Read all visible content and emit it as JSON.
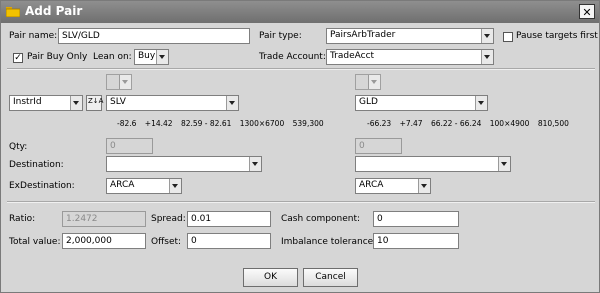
{
  "window": {
    "title": "Add Pair",
    "close_label": "✕"
  },
  "top": {
    "pair_name_label": "Pair name:",
    "pair_name_value": "SLV/GLD",
    "pair_type_label": "Pair type:",
    "pair_type_value": "PairsArbTrader",
    "pause_targets_label": "Pause targets first",
    "pause_targets_checked": false,
    "pair_buy_only_label": "Pair Buy Only",
    "pair_buy_only_checked": true,
    "lean_on_label": "Lean on:",
    "lean_on_value": "Buy",
    "trade_account_label": "Trade Account:",
    "trade_account_value": "TradeAcct"
  },
  "legs": {
    "instr_id_value": "InstrId",
    "sort_icon_text": "Z↓A",
    "left": {
      "symbol": "SLV",
      "quote": [
        "-82.6",
        "+14.42",
        "82.59 - 82.61",
        "1300×6700",
        "539,300"
      ],
      "qty": "0",
      "destination": "",
      "exdestination": "ARCA"
    },
    "right": {
      "symbol": "GLD",
      "quote": [
        "-66.23",
        "+7.47",
        "66.22 - 66.24",
        "100×4900",
        "810,500"
      ],
      "qty": "0",
      "destination": "",
      "exdestination": "ARCA"
    },
    "qty_label": "Qty:",
    "destination_label": "Destination:",
    "exdestination_label": "ExDestination:"
  },
  "params": {
    "ratio_label": "Ratio:",
    "ratio_value": "1.2472",
    "spread_label": "Spread:",
    "spread_value": "0.01",
    "cash_component_label": "Cash component:",
    "cash_component_value": "0",
    "total_value_label": "Total value:",
    "total_value_value": "2,000,000",
    "offset_label": "Offset:",
    "offset_value": "0",
    "imbalance_tolerance_label": "Imbalance tolerance:",
    "imbalance_tolerance_value": "10"
  },
  "buttons": {
    "ok_label": "OK",
    "cancel_label": "Cancel"
  },
  "colors": {
    "titlebar": "#7f7f7f",
    "background": "#d6d6d6",
    "folder_icon": "#f2c200"
  }
}
